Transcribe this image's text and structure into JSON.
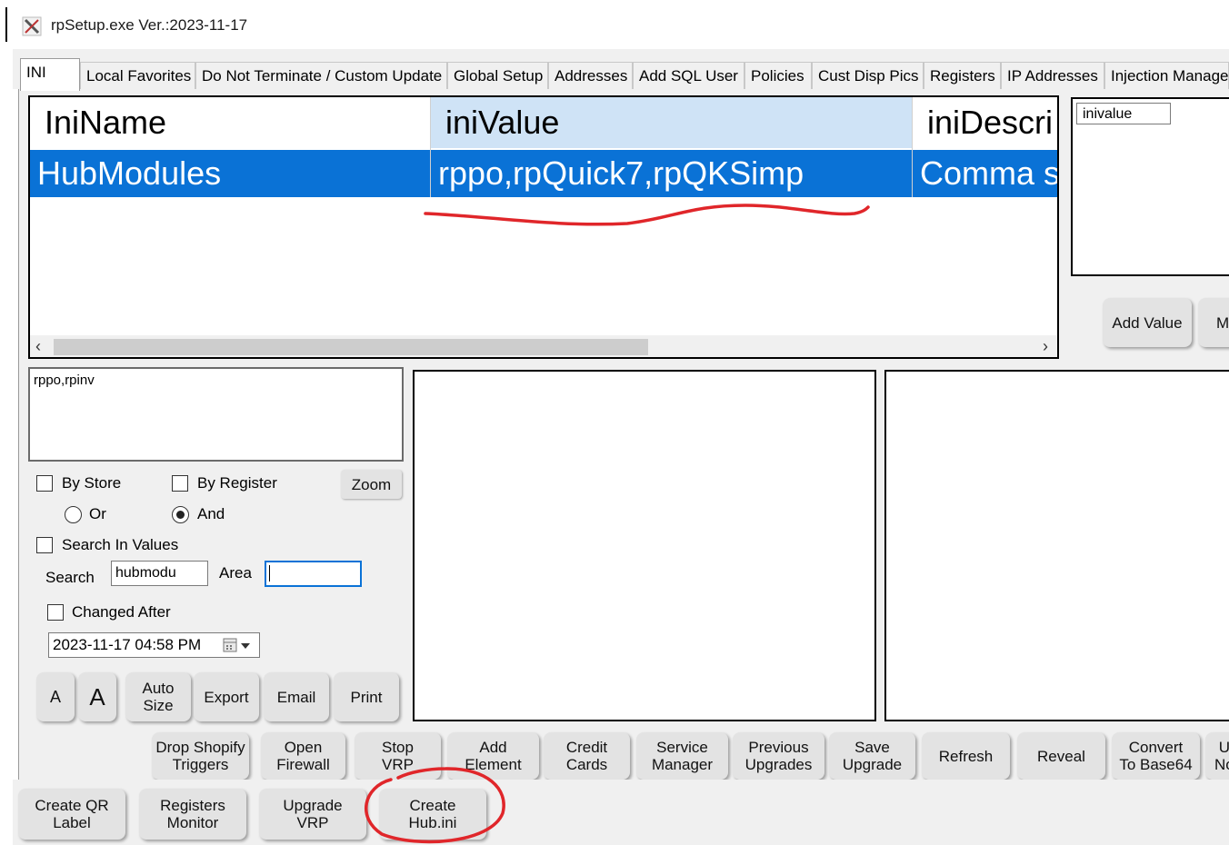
{
  "window": {
    "title": "rpSetup.exe Ver.:2023-11-17"
  },
  "tabs": [
    {
      "label": "INI",
      "active": true
    },
    {
      "label": "Local Favorites"
    },
    {
      "label": "Do Not Terminate / Custom Update"
    },
    {
      "label": "Global Setup"
    },
    {
      "label": "Addresses"
    },
    {
      "label": "Add SQL User"
    },
    {
      "label": "Policies"
    },
    {
      "label": "Cust Disp Pics"
    },
    {
      "label": "Registers"
    },
    {
      "label": "IP Addresses"
    },
    {
      "label": "Injection Manager"
    }
  ],
  "grid": {
    "columns": [
      "IniName",
      "iniValue",
      "iniDescri"
    ],
    "rows": [
      [
        "HubModules",
        "rppo,rpQuick7,rpQKSimp",
        "Comma s"
      ]
    ]
  },
  "value_box": {
    "input_value": "inivalue"
  },
  "buttons_right": {
    "add_value": "Add Value",
    "cut_label": "M"
  },
  "memo_text": "rppo,rpinv",
  "filters": {
    "by_store": "By Store",
    "by_register": "By Register",
    "zoom": "Zoom",
    "or": "Or",
    "and": "And",
    "search_in_values": "Search In Values",
    "search_label": "Search",
    "search_value": "hubmodu",
    "area_label": "Area",
    "area_value": "",
    "changed_after": "Changed After",
    "date_value": "2023-11-17 04:58 PM"
  },
  "small_buttons": [
    "A",
    "A",
    "Auto\nSize",
    "Export",
    "Email",
    "Print"
  ],
  "action_buttons": [
    "Drop Shopify\nTriggers",
    "Open\nFirewall",
    "Stop\nVRP",
    "Add\nElement",
    "Credit\nCards",
    "Service\nManager",
    "Previous\nUpgrades",
    "Save\nUpgrade",
    "Refresh",
    "Reveal",
    "Convert\nTo Base64",
    "U\nNo"
  ],
  "bottom_buttons": [
    "Create QR\nLabel",
    "Registers\nMonitor",
    "Upgrade\nVRP",
    "Create\nHub.ini"
  ],
  "annotations": {
    "color": "#e0262a"
  }
}
